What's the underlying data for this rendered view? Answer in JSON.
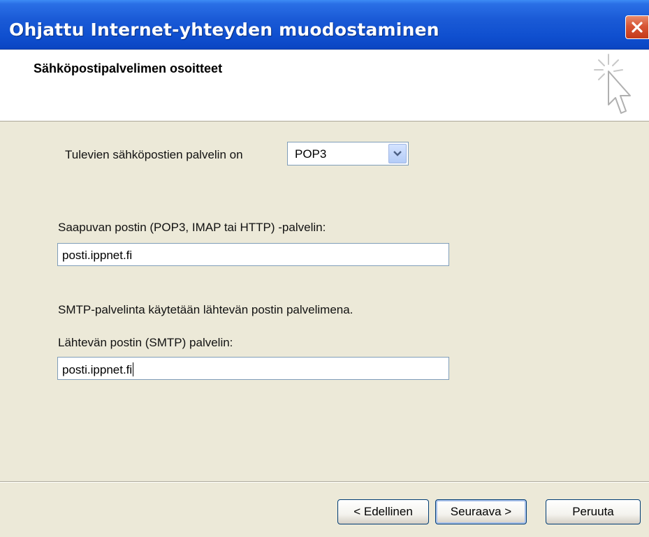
{
  "window": {
    "title": "Ohjattu Internet-yhteyden muodostaminen",
    "close_icon": "close-icon"
  },
  "header": {
    "title": "Sähköpostipalvelimen osoitteet",
    "icon": "wizard-pointer-icon"
  },
  "incoming_type": {
    "label": "Tulevien sähköpostien palvelin on",
    "selected": "POP3"
  },
  "incoming_server": {
    "label": "Saapuvan postin (POP3, IMAP tai HTTP) -palvelin:",
    "value": "posti.ippnet.fi"
  },
  "smtp_note": "SMTP-palvelinta käytetään lähtevän postin palvelimena.",
  "outgoing_server": {
    "label": "Lähtevän postin (SMTP) palvelin:",
    "value": "posti.ippnet.fi"
  },
  "buttons": {
    "back": "< Edellinen",
    "next": "Seuraava >",
    "cancel": "Peruuta"
  }
}
